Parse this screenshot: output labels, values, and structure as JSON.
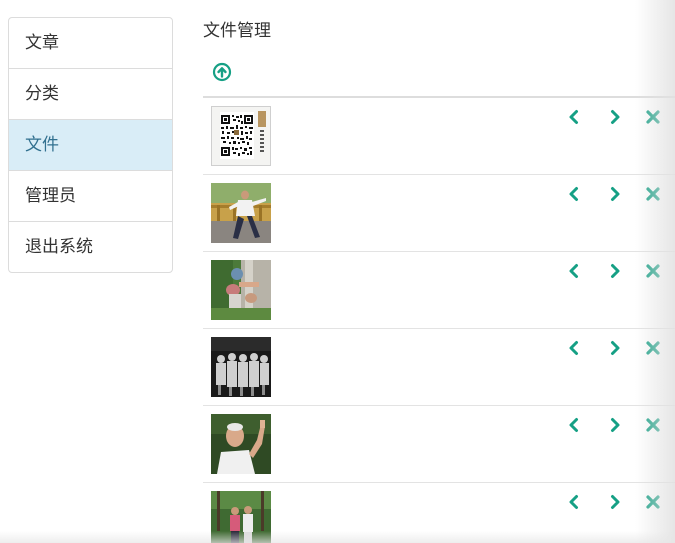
{
  "sidebar": {
    "items": [
      {
        "label": "文章",
        "active": false
      },
      {
        "label": "分类",
        "active": false
      },
      {
        "label": "文件",
        "active": true
      },
      {
        "label": "管理员",
        "active": false
      },
      {
        "label": "退出系统",
        "active": false
      }
    ]
  },
  "main": {
    "title": "文件管理",
    "upload_icon": "arrow-circle-up-icon",
    "files": [
      {
        "thumbnail": "qr-code-image"
      },
      {
        "thumbnail": "tai-chi-yard-photo"
      },
      {
        "thumbnail": "tree-figures-photo"
      },
      {
        "thumbnail": "group-portrait-photo"
      },
      {
        "thumbnail": "elder-gesture-photo"
      },
      {
        "thumbnail": "park-couple-photo"
      }
    ],
    "row_actions": [
      {
        "icon": "chevron-left-icon"
      },
      {
        "icon": "chevron-right-icon"
      },
      {
        "icon": "remove-icon"
      }
    ]
  },
  "colors": {
    "accent": "#16a085",
    "active_bg": "#d9edf7",
    "active_text": "#31708f",
    "border": "#dcdcdc"
  }
}
